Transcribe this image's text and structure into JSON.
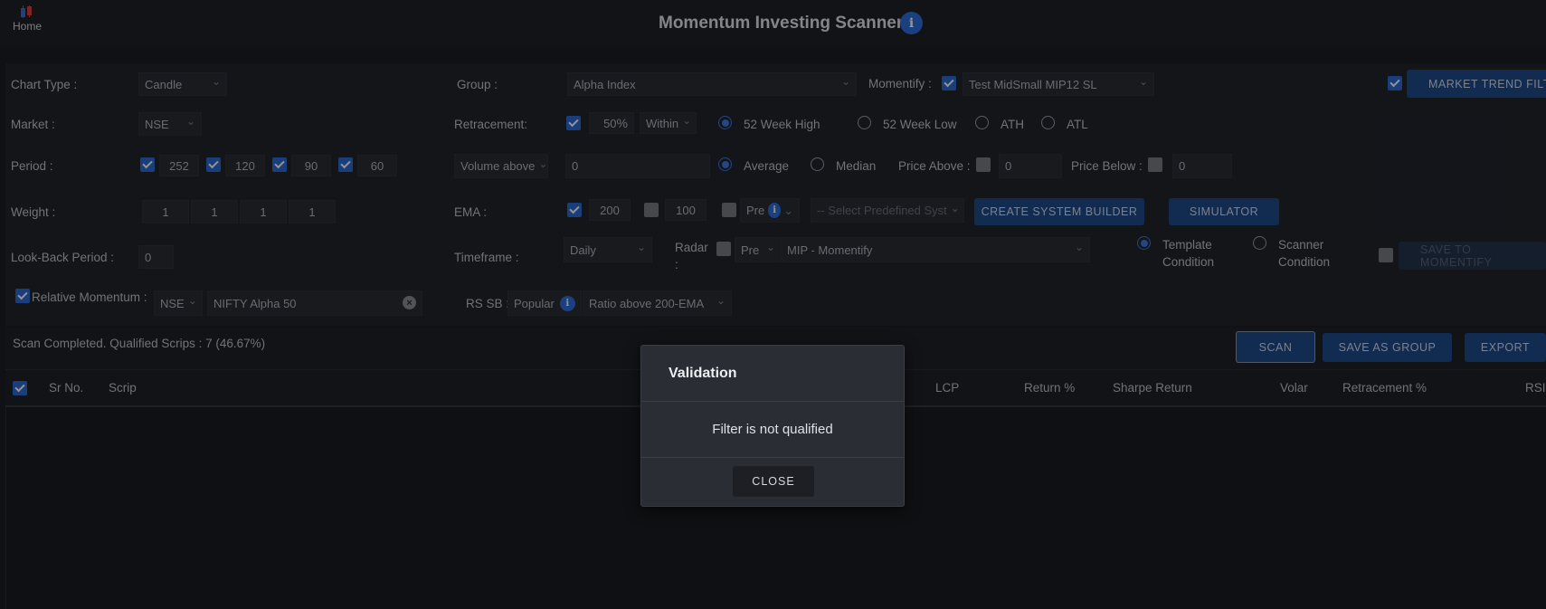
{
  "header": {
    "home_label": "Home",
    "title": "Momentum Investing Scanner",
    "info_glyph": "i"
  },
  "chart_type": {
    "label": "Chart Type :",
    "value": "Candle"
  },
  "market": {
    "label": "Market :",
    "value": "NSE"
  },
  "period": {
    "label": "Period :",
    "values": [
      "252",
      "120",
      "90",
      "60"
    ]
  },
  "weight": {
    "label": "Weight :",
    "values": [
      "1",
      "1",
      "1",
      "1"
    ]
  },
  "lookback": {
    "label": "Look-Back Period :",
    "value": "0"
  },
  "relative_momentum": {
    "label": "Relative Momentum :",
    "market": "NSE",
    "index": "NIFTY Alpha 50",
    "clear_glyph": "×"
  },
  "group": {
    "label": "Group :",
    "value": "Alpha Index"
  },
  "momentify": {
    "label": "Momentify :",
    "value": "Test MidSmall MIP12 SL"
  },
  "market_trend": {
    "button": "MARKET TREND FILTER"
  },
  "retracement": {
    "label": "Retracement:",
    "percent": "50",
    "percent_sign": "%",
    "mode": "Within",
    "options": [
      "52 Week High",
      "52 Week Low",
      "ATH",
      "ATL"
    ],
    "selected": "52 Week High"
  },
  "volume": {
    "select": "Volume above",
    "value": "0",
    "options": [
      "Average",
      "Median"
    ],
    "selected": "Average"
  },
  "price": {
    "above_label": "Price Above :",
    "above_value": "0",
    "below_label": "Price Below :",
    "below_value": "0"
  },
  "ema": {
    "label": "EMA :",
    "values": [
      "200",
      "100"
    ],
    "pre": "Pre",
    "predefined_placeholder": "-- Select Predefined Syst",
    "create_button": "CREATE SYSTEM BUILDER",
    "simulator_button": "SIMULATOR"
  },
  "timeframe": {
    "label": "Timeframe :",
    "value": "Daily",
    "radar_label_1": "Radar",
    "radar_label_2": ":",
    "pre": "Pre",
    "radar_value": "MIP - Momentify"
  },
  "condition": {
    "template_1": "Template",
    "template_2": "Condition",
    "scanner_1": "Scanner",
    "scanner_2": "Condition",
    "save_button": "SAVE TO MOMENTIFY"
  },
  "rssb": {
    "label": "RS SB :",
    "popular": "Popular",
    "ratio": "Ratio above 200-EMA"
  },
  "status": {
    "text": "Scan Completed. Qualified Scrips : 7 (46.67%)",
    "scan_button": "SCAN",
    "save_group_button": "SAVE AS GROUP",
    "export_button": "EXPORT"
  },
  "table": {
    "columns": [
      "Sr No.",
      "Scrip",
      "LCP",
      "Return %",
      "Sharpe Return",
      "Volar",
      "Retracement %",
      "RSI"
    ]
  },
  "modal": {
    "title": "Validation",
    "message": "Filter is not qualified",
    "close_button": "CLOSE"
  },
  "colors": {
    "accent": "#2b6cd4",
    "button_blue": "#1f4a8c",
    "background": "#1b1e24"
  },
  "icons": {
    "home": "logo-icon",
    "info": "info-icon",
    "clear": "close-circle-icon",
    "dropdown": "chevron-down-icon"
  }
}
